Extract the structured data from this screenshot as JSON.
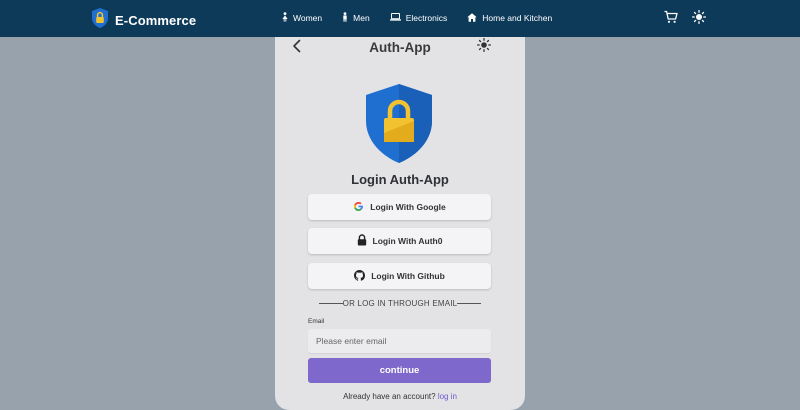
{
  "navbar": {
    "brand": "E-Commerce",
    "links": [
      {
        "label": "Women",
        "icon": "woman-icon"
      },
      {
        "label": "Men",
        "icon": "man-icon"
      },
      {
        "label": "Electronics",
        "icon": "laptop-icon"
      },
      {
        "label": "Home and Kitchen",
        "icon": "home-icon"
      }
    ],
    "icons": [
      "cart-icon",
      "sun-icon"
    ]
  },
  "card": {
    "title": "Auth-App",
    "heading": "Login Auth-App",
    "providers": {
      "google": "Login With Google",
      "auth0": "Login With Auth0",
      "github": "Login With Github"
    },
    "divider": "OR LOG IN THROUGH EMAIL",
    "email_label": "Email",
    "email_placeholder": "Please enter email",
    "continue_label": "continue",
    "signup_prompt": "Already have an account?",
    "signup_link": "log in"
  },
  "colors": {
    "navbar": "#0e3a5a",
    "backdrop": "#98a2ad",
    "card": "#e3e3e5",
    "primary": "#7e68cb",
    "shield": "#1f6fd1",
    "lock": "#f2c230"
  }
}
